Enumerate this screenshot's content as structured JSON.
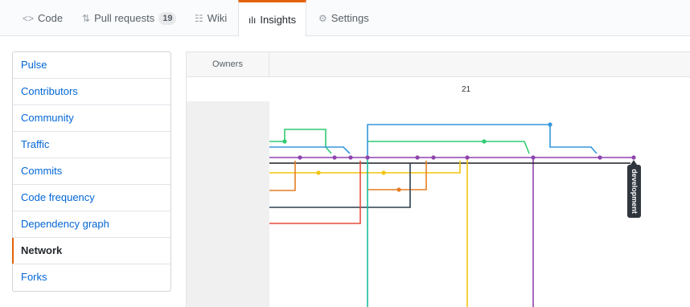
{
  "tabs": [
    {
      "icon": "<>",
      "label": "Code"
    },
    {
      "icon": "⇅",
      "label": "Pull requests",
      "count": "19"
    },
    {
      "icon": "☷",
      "label": "Wiki"
    },
    {
      "icon": "ılı",
      "label": "Insights"
    },
    {
      "icon": "⚙",
      "label": "Settings"
    }
  ],
  "sidebar": {
    "items": [
      {
        "label": "Pulse"
      },
      {
        "label": "Contributors"
      },
      {
        "label": "Community"
      },
      {
        "label": "Traffic"
      },
      {
        "label": "Commits"
      },
      {
        "label": "Code frequency"
      },
      {
        "label": "Dependency graph"
      },
      {
        "label": "Network"
      },
      {
        "label": "Forks"
      }
    ]
  },
  "network": {
    "owners_header": "Owners",
    "date_label": "21",
    "branch_label": "development"
  },
  "colors": {
    "accent": "#e36209",
    "link": "#0366d6",
    "branch_green": "#2ecc71",
    "branch_blue": "#3498db",
    "branch_purple": "#8e44ad",
    "branch_black": "#1b1f23",
    "branch_yellow": "#f1c40f",
    "branch_orange": "#e67e22",
    "branch_navy": "#2c3e50",
    "branch_red": "#e74c3c",
    "branch_teal": "#1abc9c"
  }
}
